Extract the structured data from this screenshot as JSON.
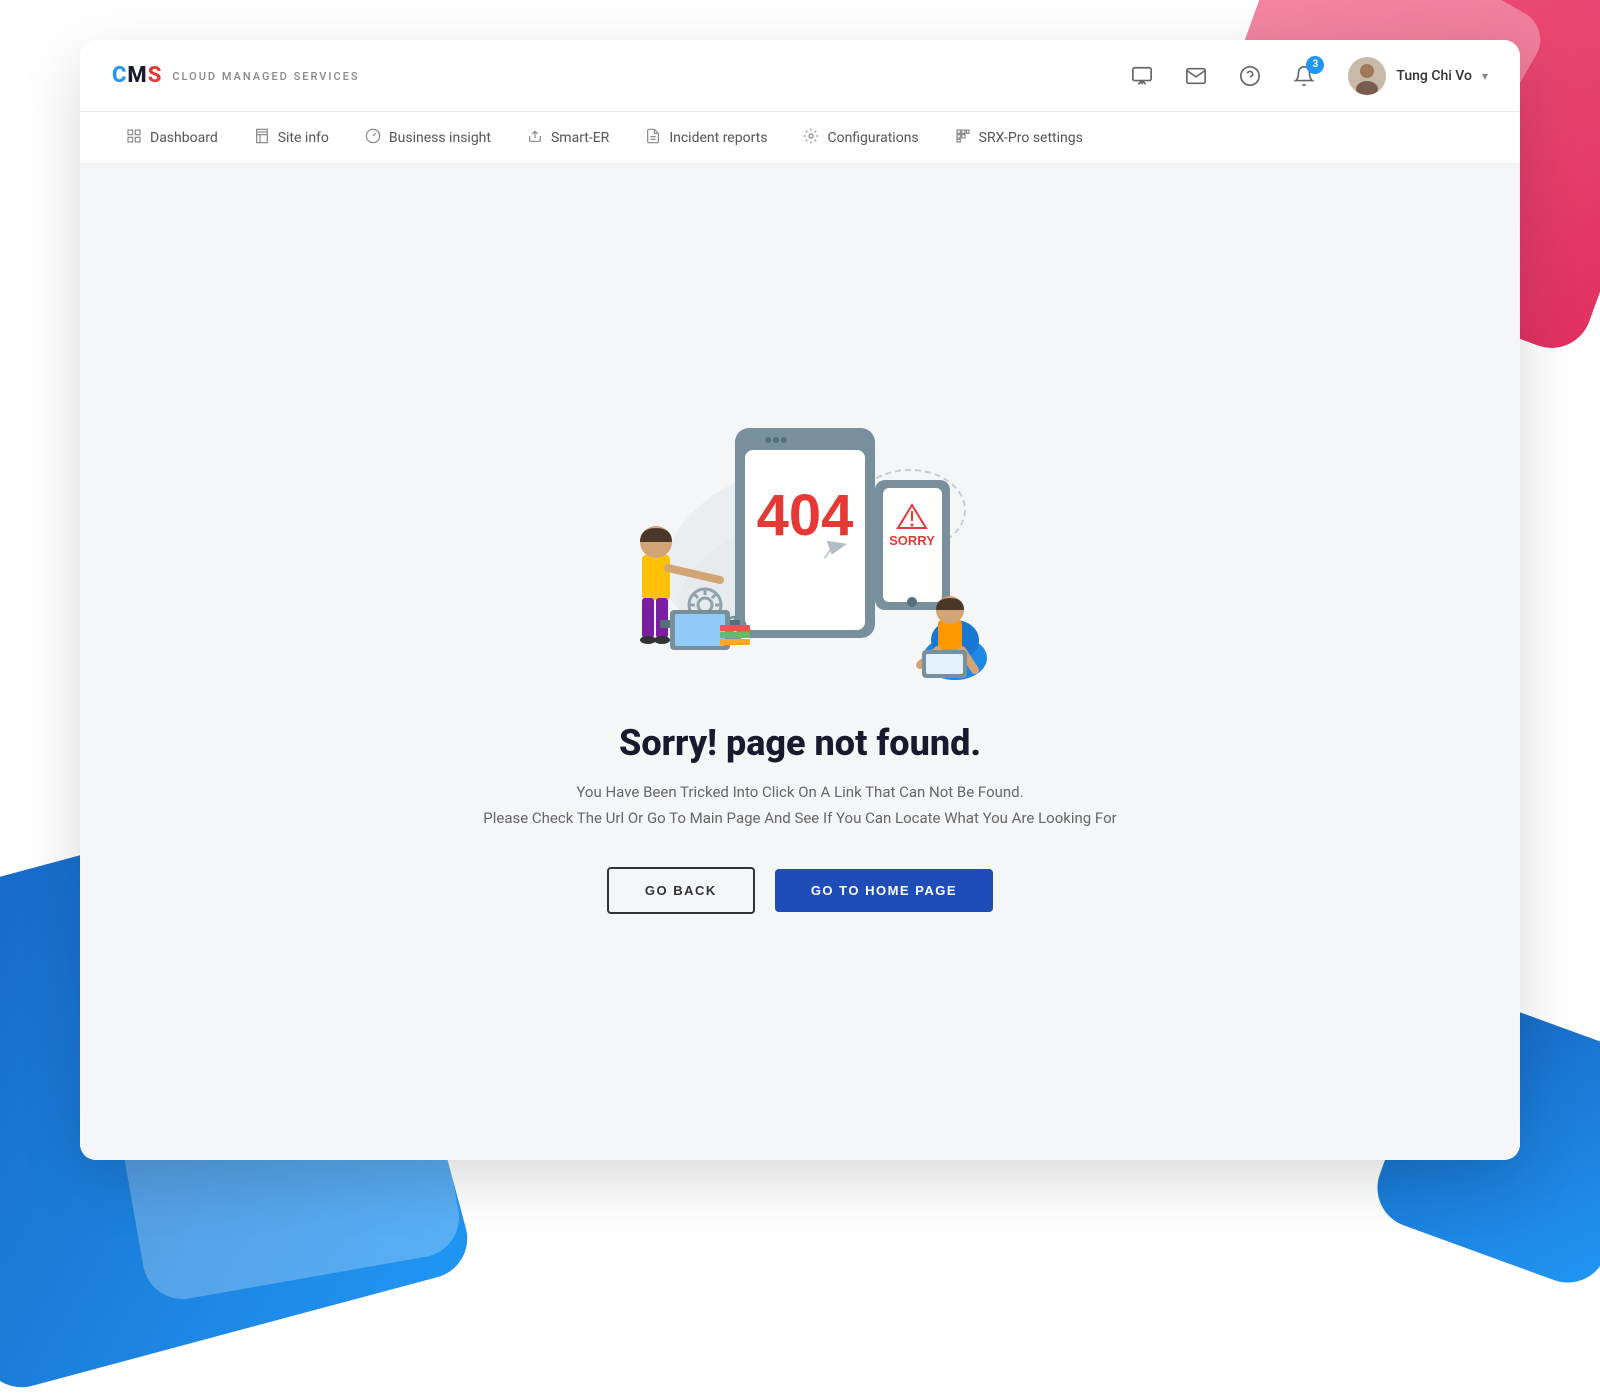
{
  "app": {
    "logo": {
      "letters": [
        "C",
        "M",
        "S"
      ],
      "subtitle": "CLOUD MANAGED SERVICES"
    },
    "header": {
      "user_name": "Tung Chi Vo",
      "notification_count": "3"
    },
    "nav": {
      "items": [
        {
          "id": "dashboard",
          "label": "Dashboard",
          "icon": "grid"
        },
        {
          "id": "site-info",
          "label": "Site info",
          "icon": "building"
        },
        {
          "id": "business-insight",
          "label": "Business insight",
          "icon": "chart"
        },
        {
          "id": "smart-er",
          "label": "Smart-ER",
          "icon": "upload"
        },
        {
          "id": "incident-reports",
          "label": "Incident reports",
          "icon": "doc"
        },
        {
          "id": "configurations",
          "label": "Configurations",
          "icon": "gear"
        },
        {
          "id": "srx-pro-settings",
          "label": "SRX-Pro settings",
          "icon": "grid2"
        }
      ]
    }
  },
  "error_page": {
    "error_code": "404",
    "sorry_label": "SORRY",
    "title": "Sorry! page not found.",
    "description_line1": "You Have Been Tricked Into Click On A Link That Can Not Be Found.",
    "description_line2": "Please Check The Url Or Go To Main Page And See If You Can Locate What You Are Looking For",
    "go_back_label": "GO BACK",
    "go_home_label": "GO TO HOME PAGE"
  },
  "colors": {
    "accent_blue": "#1e4db7",
    "accent_red": "#e53935",
    "bg_light": "#f5f6f8",
    "text_dark": "#1a1a2e",
    "text_gray": "#666666"
  }
}
